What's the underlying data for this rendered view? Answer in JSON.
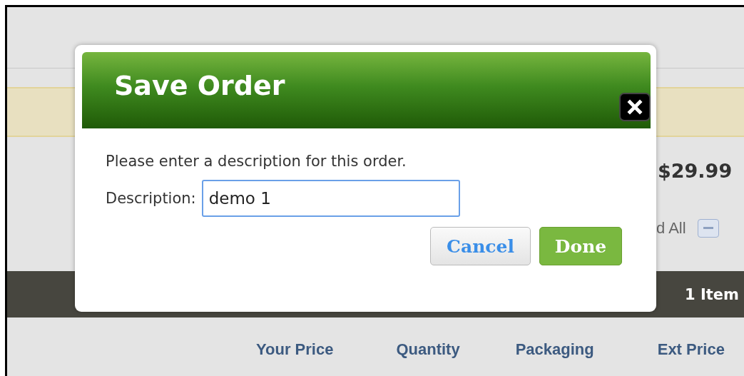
{
  "page": {
    "price": "$29.99",
    "toggle_link": "d All",
    "item_count": "1 Item",
    "columns": [
      "Your Price",
      "Quantity",
      "Packaging",
      "Ext Price"
    ]
  },
  "dialog": {
    "title": "Save Order",
    "message": "Please enter a description for this order.",
    "field": {
      "label": "Description:",
      "value": "demo 1"
    },
    "buttons": [
      {
        "label": "Cancel",
        "kind": "secondary"
      },
      {
        "label": "Done",
        "kind": "primary"
      }
    ]
  }
}
